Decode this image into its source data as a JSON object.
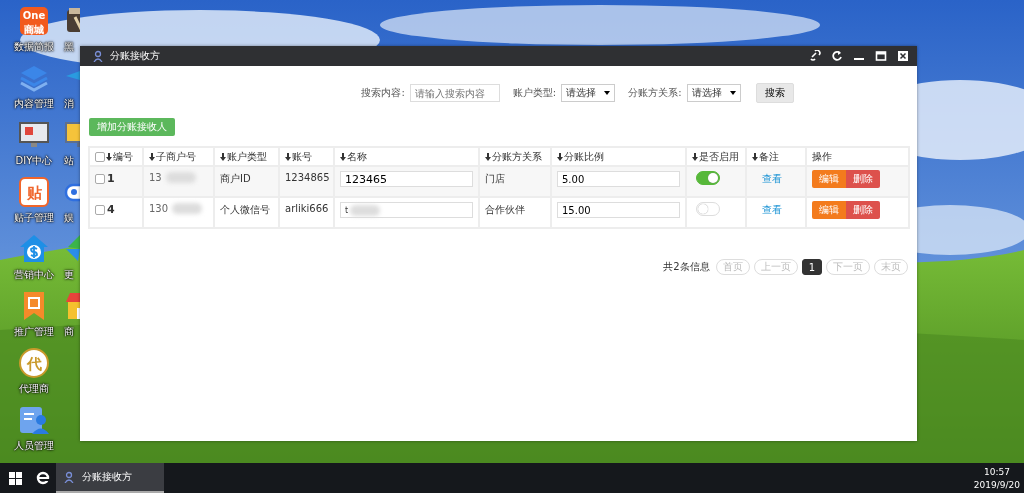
{
  "desktop": {
    "column_1": [
      {
        "label": "数据简报",
        "kind": "one",
        "badge": "One",
        "sub": "商城"
      },
      {
        "label": "内容管理",
        "kind": "layers"
      },
      {
        "label": "DIY中心",
        "kind": "monitor"
      },
      {
        "label": "贴子管理",
        "kind": "glyph",
        "glyph": "贴"
      },
      {
        "label": "营销中心",
        "kind": "dollar"
      },
      {
        "label": "推广管理",
        "kind": "ribbon"
      },
      {
        "label": "代理商",
        "kind": "circle",
        "glyph": "代"
      },
      {
        "label": "人员管理",
        "kind": "person"
      }
    ],
    "column_2": [
      {
        "label": "黑",
        "kind": "card"
      },
      {
        "label": "消",
        "kind": "plane"
      },
      {
        "label": "站",
        "kind": "screen"
      },
      {
        "label": "娱",
        "kind": "game"
      },
      {
        "label": "更",
        "kind": "pinwheel"
      },
      {
        "label": "商",
        "kind": "shop"
      }
    ]
  },
  "window": {
    "title": "分账接收方",
    "controls": [
      {
        "kind": "link"
      },
      {
        "kind": "refresh"
      },
      {
        "kind": "minimize"
      },
      {
        "kind": "maximize"
      },
      {
        "kind": "close"
      }
    ],
    "search": {
      "fields": [
        {
          "kind": "text",
          "label": "搜索内容:",
          "placeholder": "请输入搜索内容"
        },
        {
          "kind": "select",
          "label": "账户类型:",
          "value": "请选择"
        },
        {
          "kind": "select",
          "label": "分账方关系:",
          "value": "请选择"
        }
      ],
      "button": "搜索"
    },
    "add_button": "增加分账接收人",
    "table": {
      "columns": [
        {
          "label": "编号",
          "sortable": true,
          "checked": false
        },
        {
          "label": "子商户号",
          "sortable": true
        },
        {
          "label": "账户类型",
          "sortable": true
        },
        {
          "label": "账号",
          "sortable": true
        },
        {
          "label": "名称",
          "sortable": true
        },
        {
          "label": "分账方关系",
          "sortable": true
        },
        {
          "label": "分账比例",
          "sortable": true
        },
        {
          "label": "是否启用",
          "sortable": true
        },
        {
          "label": "备注",
          "sortable": true
        },
        {
          "label": "操作",
          "sortable": false
        }
      ],
      "rows": [
        {
          "checked": false,
          "id": "1",
          "sub_merchant": "13",
          "redacted": true,
          "account_type": "商户ID",
          "account": "1234865",
          "name": "123465",
          "name_redacted": false,
          "relation": "门店",
          "ratio": "5.00",
          "enabled": true,
          "note": "查看",
          "actions": [
            "编辑",
            "删除"
          ]
        },
        {
          "checked": false,
          "id": "4",
          "sub_merchant": "130",
          "redacted": true,
          "account_type": "个人微信号",
          "account": "arliki666",
          "name": "t",
          "name_redacted": true,
          "relation": "合作伙伴",
          "ratio": "15.00",
          "enabled": false,
          "note": "查看",
          "actions": [
            "编辑",
            "删除"
          ]
        }
      ]
    },
    "pagination": {
      "summary": "共2条信息",
      "pages": [
        {
          "label": "首页",
          "selected": false,
          "disabled": true
        },
        {
          "label": "上一页",
          "selected": false,
          "disabled": true
        },
        {
          "label": "1",
          "selected": true,
          "disabled": false
        },
        {
          "label": "下一页",
          "selected": false,
          "disabled": true
        },
        {
          "label": "末页",
          "selected": false,
          "disabled": true
        }
      ]
    }
  },
  "taskbar": {
    "tasks": [
      {
        "title": "分账接收方",
        "selected": true
      }
    ],
    "time": "10:57",
    "date": "2019/9/20"
  }
}
